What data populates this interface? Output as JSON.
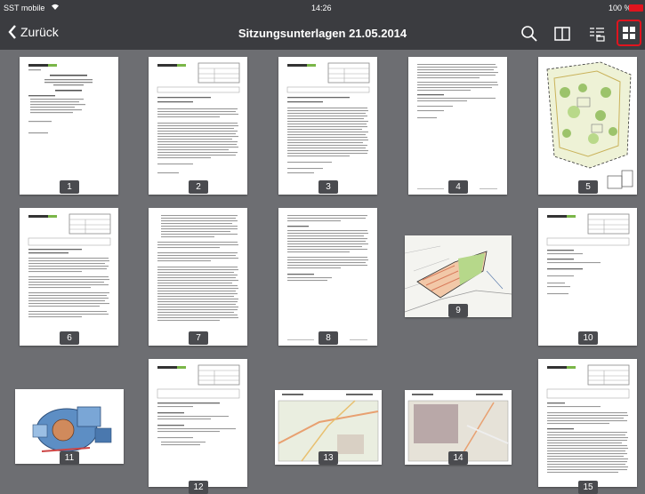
{
  "status": {
    "carrier": "SST mobile",
    "time": "14:26",
    "battery": "100 %"
  },
  "nav": {
    "back_label": "Zurück",
    "title": "Sitzungsunterlagen 21.05.2014"
  },
  "pages": [
    "1",
    "2",
    "3",
    "4",
    "5",
    "6",
    "7",
    "8",
    "9",
    "10",
    "11",
    "12",
    "13",
    "14",
    "15"
  ],
  "colors": {
    "accent": "#e0141e",
    "bar": "#3b3c40",
    "background": "#6d6e72"
  }
}
